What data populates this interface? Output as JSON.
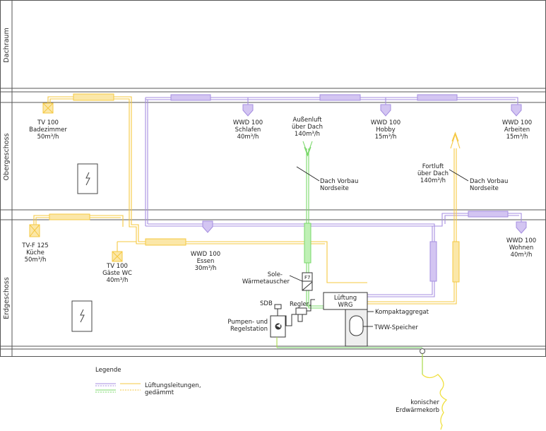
{
  "floors": {
    "attic": "Dachraum",
    "upper": "Obergeschoss",
    "ground": "Erdgeschoss"
  },
  "outlets": {
    "bathroom": [
      "TV 100",
      "Badezimmer",
      "50m³/h"
    ],
    "sleeping": [
      "WWD 100",
      "Schlafen",
      "40m³/h"
    ],
    "hobby": [
      "WWD 100",
      "Hobby",
      "15m³/h"
    ],
    "work": [
      "WWD 100",
      "Arbeiten",
      "15m³/h"
    ],
    "kitchen": [
      "TV-F 125",
      "Küche",
      "50m³/h"
    ],
    "guest_wc": [
      "TV 100",
      "Gäste WC",
      "40m³/h"
    ],
    "dining": [
      "WWD 100",
      "Essen",
      "30m³/h"
    ],
    "living": [
      "WWD 100",
      "Wohnen",
      "40m³/h"
    ]
  },
  "air": {
    "outside": [
      "Außenluft",
      "über Dach",
      "140m³/h"
    ],
    "exhaust": [
      "Fortluft",
      "über Dach",
      "140m³/h"
    ],
    "roof_left": [
      "Dach Vorbau",
      "Nordseite"
    ],
    "roof_right": [
      "Dach Vorbau",
      "Nordseite"
    ]
  },
  "components": {
    "brine_hx": [
      "Sole-",
      "Wärmetauscher"
    ],
    "filter": "F7",
    "sdb": "SDB",
    "controller": "Regler",
    "pump_station": [
      "Pumpen- und",
      "Regelstation"
    ],
    "unit": [
      "Lüftung",
      "WRG"
    ],
    "compact": "Kompaktaggregat",
    "tank": "TWW-Speicher",
    "ground_hx": [
      "konischer",
      "Erdwärmekorb"
    ]
  },
  "legend": {
    "title": "Legende",
    "label": [
      "Lüftungsleitungen,",
      "gedämmt"
    ]
  },
  "colors": {
    "supply": "#f5c842",
    "extract": "#a58ee0",
    "outside_air": "#7ad86a",
    "supply_fill": "#fbe7a8",
    "extract_fill": "#d3c5f2",
    "outside_fill": "#bff0b5",
    "frame": "#555555"
  }
}
